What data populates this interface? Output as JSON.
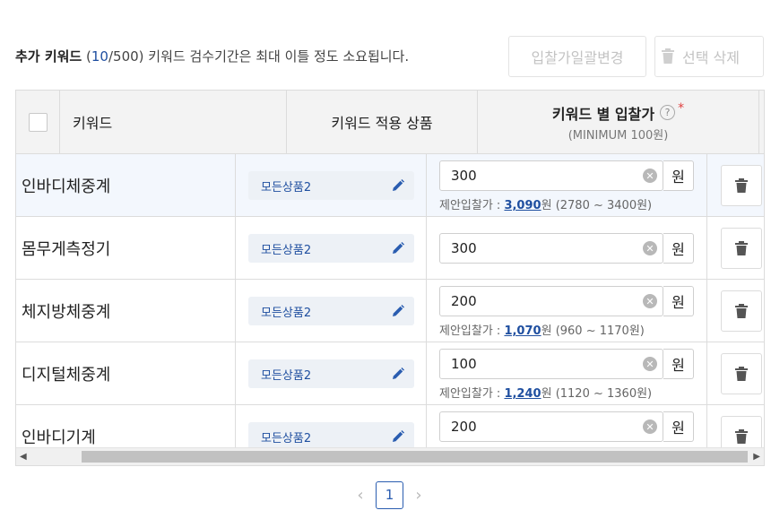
{
  "summary": {
    "label": "추가 키워드",
    "open_paren": "(",
    "current": "10",
    "slash_total": "/500)",
    "note": "키워드 검수기간은 최대 이틀 정도 소요됩니다."
  },
  "toolbar": {
    "bulk_label": "입찰가일괄변경",
    "delete_label": "선택 삭제"
  },
  "table": {
    "headers": {
      "keyword": "키워드",
      "product": "키워드 적용 상품",
      "bid": "키워드 별 입찰가",
      "bid_sub": "(MINIMUM 100원)",
      "help": "?",
      "required": "*"
    },
    "unit": "원",
    "suggest_prefix": "제안입찰가 : ",
    "rows": [
      {
        "keyword": "인바디체중계",
        "product": "모든상품2",
        "bid": "300",
        "suggest_price": "3,090",
        "suggest_unit": "원",
        "suggest_range": "(2780 ~ 3400원)",
        "highlighted": true
      },
      {
        "keyword": "몸무게측정기",
        "product": "모든상품2",
        "bid": "300"
      },
      {
        "keyword": "체지방체중계",
        "product": "모든상품2",
        "bid": "200",
        "suggest_price": "1,070",
        "suggest_unit": "원",
        "suggest_range": "(960 ~ 1170원)"
      },
      {
        "keyword": "디지털체중계",
        "product": "모든상품2",
        "bid": "100",
        "suggest_price": "1,240",
        "suggest_unit": "원",
        "suggest_range": "(1120 ~ 1360원)"
      },
      {
        "keyword": "인바디기계",
        "product": "모든상품2",
        "bid": "200"
      }
    ]
  },
  "pagination": {
    "prev": "‹",
    "current": "1",
    "next": "›"
  },
  "colors": {
    "accent": "#1f4fa0",
    "required": "#e04040",
    "header_bg": "#f3f3f3",
    "highlight_row": "#f3f7fd"
  }
}
